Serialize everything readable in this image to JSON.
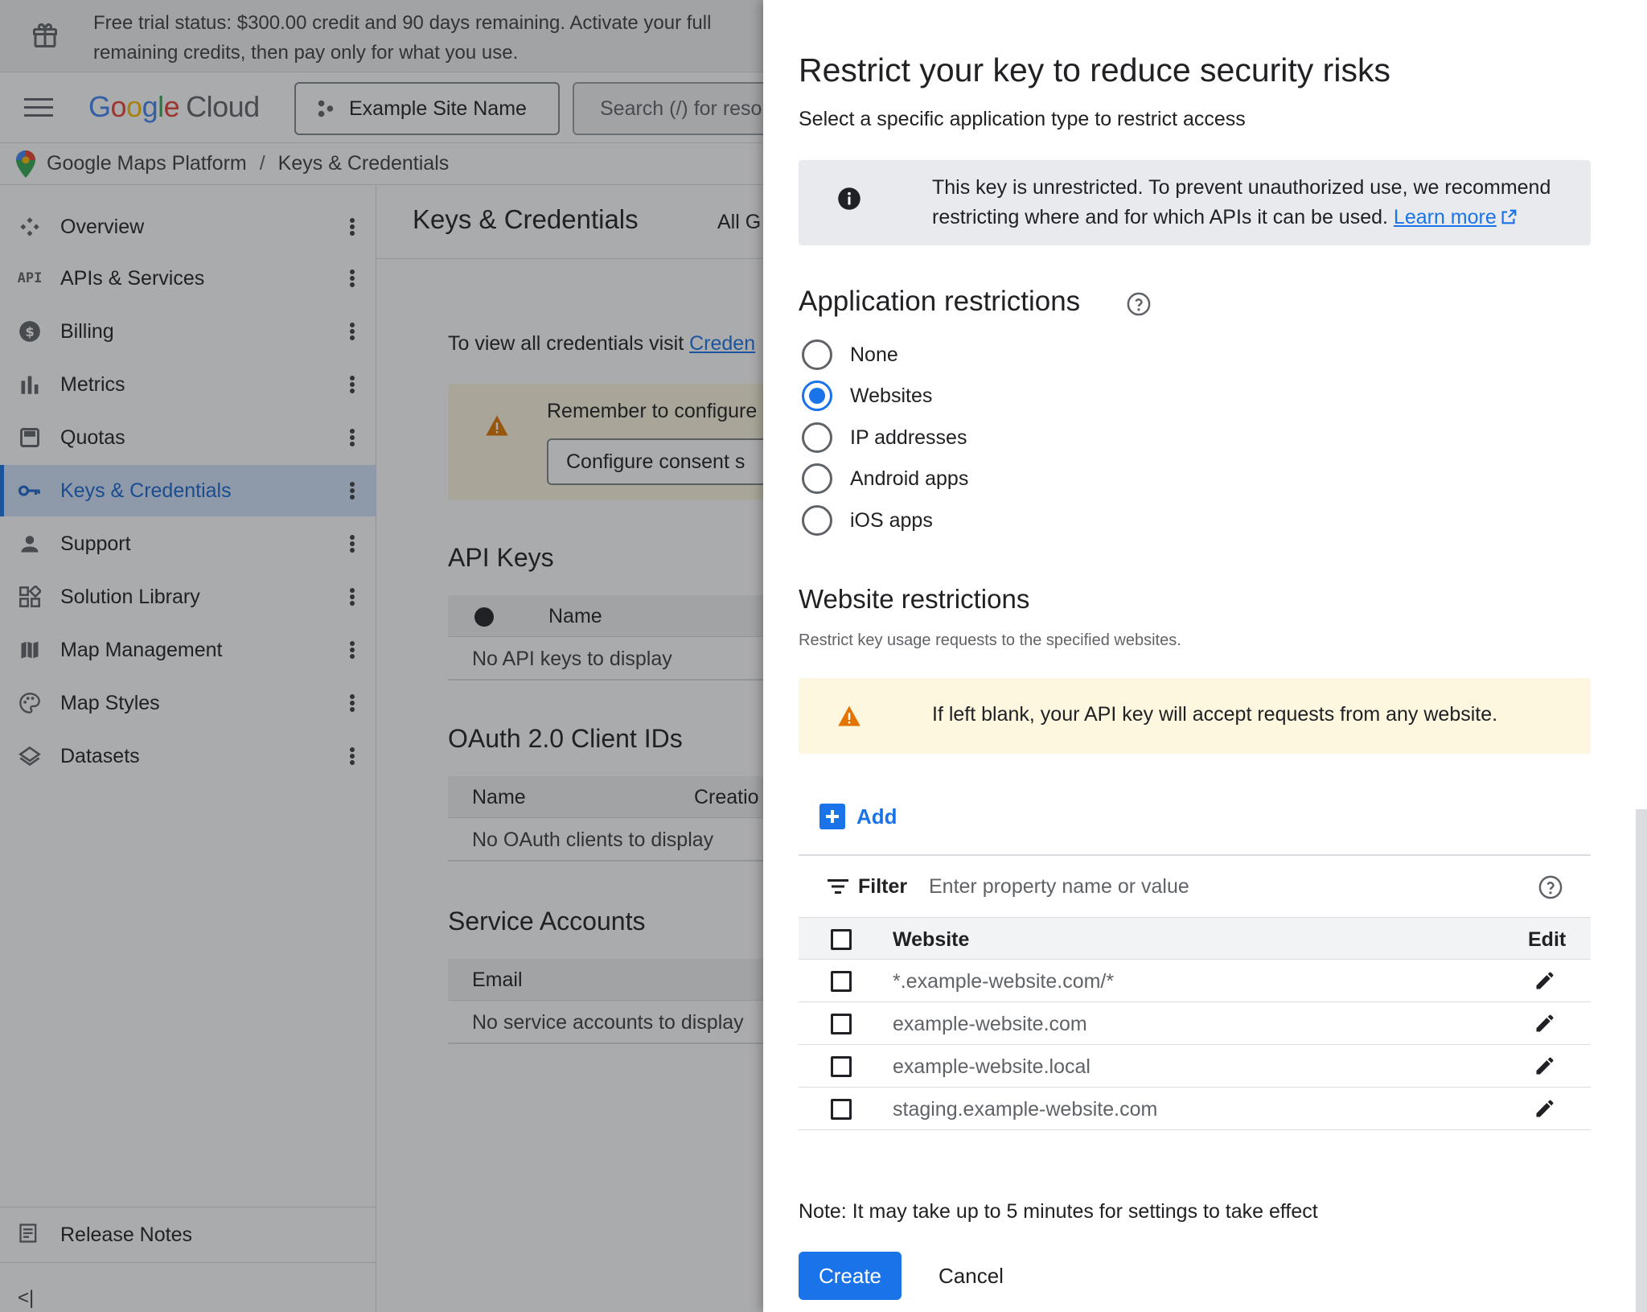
{
  "trial_banner": {
    "text": "Free trial status: $300.00 credit and 90 days remaining. Activate your full",
    "text2": "remaining credits, then pay only for what you use."
  },
  "header": {
    "logo_letters": [
      "G",
      "o",
      "o",
      "g",
      "l",
      "e"
    ],
    "logo_suffix": "Cloud",
    "project_name": "Example Site Name",
    "search_placeholder": "Search (/) for reso"
  },
  "breadcrumb": {
    "root": "Google Maps Platform",
    "separator": "/",
    "current": "Keys & Credentials"
  },
  "sidebar": {
    "items": [
      {
        "label": "Overview",
        "icon": "overview-icon"
      },
      {
        "label": "APIs & Services",
        "icon": "api-icon"
      },
      {
        "label": "Billing",
        "icon": "billing-icon"
      },
      {
        "label": "Metrics",
        "icon": "metrics-icon"
      },
      {
        "label": "Quotas",
        "icon": "quotas-icon"
      },
      {
        "label": "Keys & Credentials",
        "icon": "key-icon",
        "active": true
      },
      {
        "label": "Support",
        "icon": "person-icon"
      },
      {
        "label": "Solution Library",
        "icon": "grid-icon"
      },
      {
        "label": "Map Management",
        "icon": "map-icon"
      },
      {
        "label": "Map Styles",
        "icon": "palette-icon"
      },
      {
        "label": "Datasets",
        "icon": "layers-icon"
      }
    ],
    "release_notes": "Release Notes",
    "collapse_label": "<|"
  },
  "main": {
    "title": "Keys & Credentials",
    "filter_label": "All G",
    "visit_text": "To view all credentials visit ",
    "visit_link": "Creden",
    "banner_text": "Remember to configure",
    "banner_button": "Configure consent s",
    "api_keys": {
      "title": "API Keys",
      "col_name": "Name",
      "empty": "No API keys to display"
    },
    "oauth": {
      "title": "OAuth 2.0 Client IDs",
      "col_name": "Name",
      "col_creation": "Creatio",
      "empty": "No OAuth clients to display"
    },
    "service_accounts": {
      "title": "Service Accounts",
      "col_email": "Email",
      "empty": "No service accounts to display"
    }
  },
  "panel": {
    "title": "Restrict your key to reduce security risks",
    "subtitle": "Select a specific application type to restrict access",
    "info_text": "This key is unrestricted. To prevent unauthorized use, we recommend restricting where and for which APIs it can be used.",
    "info_link": "Learn more",
    "app_restrictions_title": "Application restrictions",
    "app_options": [
      {
        "label": "None",
        "selected": false
      },
      {
        "label": "Websites",
        "selected": true
      },
      {
        "label": "IP addresses",
        "selected": false
      },
      {
        "label": "Android apps",
        "selected": false
      },
      {
        "label": "iOS apps",
        "selected": false
      }
    ],
    "website_restrictions_title": "Website restrictions",
    "website_restrictions_desc": "Restrict key usage requests to the specified websites.",
    "blank_warning": "If left blank, your API key will accept requests from any website.",
    "add_label": "Add",
    "filter_label": "Filter",
    "filter_placeholder": "Enter property name or value",
    "table": {
      "col_website": "Website",
      "col_edit": "Edit",
      "rows": [
        "*.example-website.com/*",
        "example-website.com",
        "example-website.local",
        "staging.example-website.com"
      ]
    },
    "note": "Note: It may take up to 5 minutes for settings to take effect",
    "create_label": "Create",
    "cancel_label": "Cancel"
  },
  "colors": {
    "accent": "#1a73e8",
    "warning": "#e37400",
    "info_bg": "#e8eaed",
    "warn_bg": "#fef7e0"
  }
}
